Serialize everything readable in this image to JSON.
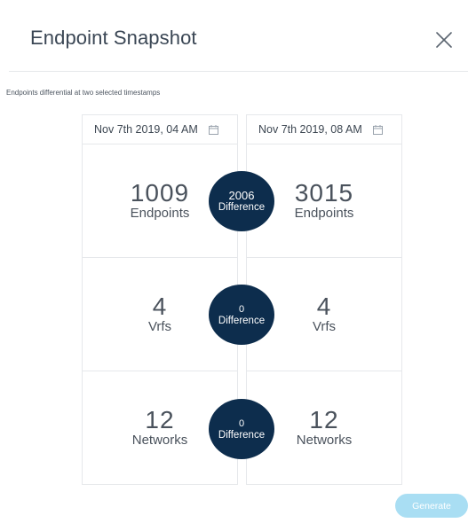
{
  "dialog": {
    "title": "Endpoint Snapshot",
    "subtitle": "Endpoints differential at two selected timestamps",
    "close_icon": "close-icon",
    "generate_label": "Generate",
    "colors": {
      "accent_dark": "#0d2d4d",
      "generate_disabled": "#a9def3"
    }
  },
  "snapshot_left": {
    "date": "Nov 7th 2019, 04 AM",
    "endpoints_value": "1009",
    "endpoints_label": "Endpoints",
    "vrfs_value": "4",
    "vrfs_label": "Vrfs",
    "networks_value": "12",
    "networks_label": "Networks"
  },
  "snapshot_right": {
    "date": "Nov 7th 2019, 08 AM",
    "endpoints_value": "3015",
    "endpoints_label": "Endpoints",
    "vrfs_value": "4",
    "vrfs_label": "Vrfs",
    "networks_value": "12",
    "networks_label": "Networks"
  },
  "differences": {
    "endpoints_value": "2006",
    "vrfs_value": "0",
    "networks_value": "0",
    "label": "Difference"
  }
}
